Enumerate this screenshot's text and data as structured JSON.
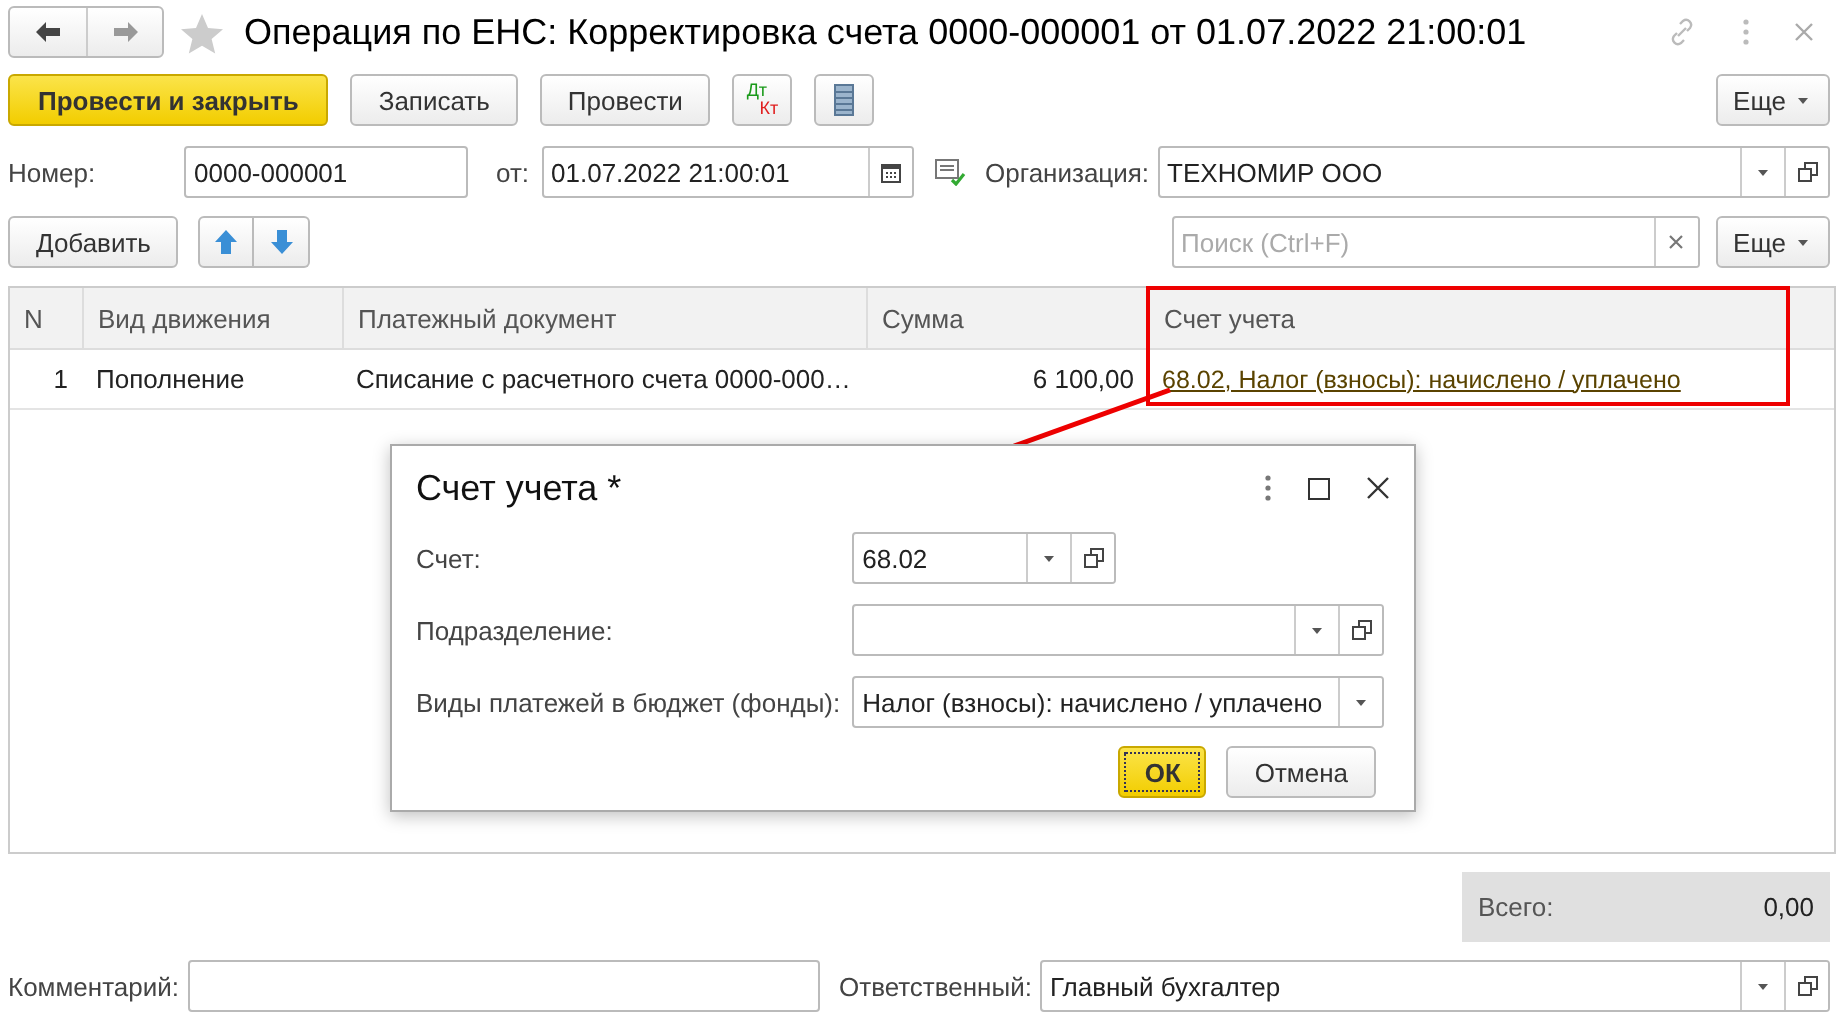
{
  "window": {
    "title": "Операция по ЕНС: Корректировка счета 0000-000001 от 01.07.2022 21:00:01"
  },
  "toolbar": {
    "buttons": [
      {
        "label": "Провести и закрыть",
        "kind": "primary"
      },
      {
        "label": "Записать",
        "kind": "normal"
      },
      {
        "label": "Провести",
        "kind": "normal"
      }
    ],
    "dt": "Дт",
    "kt": "Кт",
    "more": "Еще"
  },
  "header_fields": [
    {
      "label": "Номер:",
      "value": "0000-000001",
      "kind": "plain"
    },
    {
      "label": "от:",
      "value": "01.07.2022 21:00:01",
      "kind": "date"
    },
    {
      "label": "Организация:",
      "value": "ТЕХНОМИР ООО",
      "kind": "select-open"
    }
  ],
  "table_toolbar": {
    "add": "Добавить",
    "search_placeholder": "Поиск (Ctrl+F)",
    "more": "Еще"
  },
  "table": {
    "columns": [
      "N",
      "Вид движения",
      "Платежный документ",
      "Сумма",
      "Счет учета"
    ],
    "rows": [
      {
        "n": "1",
        "movement": "Пополнение",
        "document": "Списание с расчетного счета 0000-000…",
        "amount": "6 100,00",
        "account": "68.02, Налог (взносы): начислено / уплачено"
      }
    ]
  },
  "total": {
    "label": "Всего:",
    "value": "0,00"
  },
  "footer": {
    "comment_label": "Комментарий:",
    "responsible_label": "Ответственный:",
    "responsible_value": "Главный бухгалтер"
  },
  "dialog": {
    "title": "Счет учета *",
    "fields": [
      {
        "label": "Счет:",
        "value": "68.02",
        "kind": "select-open"
      },
      {
        "label": "Подразделение:",
        "kind": "select-open"
      },
      {
        "label": "Виды платежей в бюджет (фонды):",
        "value": "Налог (взносы): начислено / уплачено",
        "kind": "select"
      }
    ],
    "buttons": [
      {
        "label": "ОК",
        "default": true
      },
      {
        "label": "Отмена",
        "default": false
      }
    ]
  }
}
